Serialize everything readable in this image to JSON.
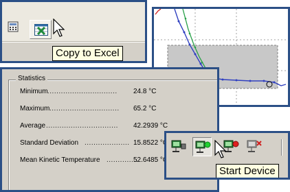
{
  "toolbar": {
    "copy_excel_tooltip": "Copy to Excel"
  },
  "statistics": {
    "title": "Statistics",
    "rows": [
      {
        "label": "Minimum",
        "dots": "...............................",
        "value": "24.8 °C"
      },
      {
        "label": "Maximum",
        "dots": "...............................",
        "value": "65.2 °C"
      },
      {
        "label": "Average",
        "dots": "................................",
        "value": "42.2939 °C"
      },
      {
        "label": "Standard Deviation",
        "dots": "....................",
        "value": "15.8522 °C"
      },
      {
        "label": "Mean Kinetic Temperature",
        "dots": "..............",
        "value": "52.6485 °C"
      }
    ]
  },
  "device_toolbar": {
    "start_device_tooltip": "Start Device"
  },
  "icons": [
    "calculator-icon",
    "excel-icon",
    "cursor-arrow-icon",
    "device-icon",
    "start-device-icon",
    "stop-device-icon",
    "delete-device-icon"
  ],
  "colors": {
    "frame": "#2b4f86",
    "tooltip_bg": "#ffffe1",
    "dialog_bg": "#d4d0c8",
    "series_blue": "#3040c0",
    "series_green": "#28a048",
    "series_red": "#d02020",
    "selection_gray": "#c8c8c8"
  }
}
